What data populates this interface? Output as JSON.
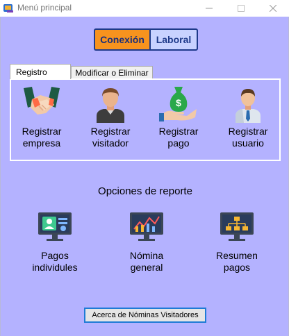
{
  "window": {
    "title": "Menú principal"
  },
  "logo": {
    "left_text": "Conexión",
    "right_text": "Laboral"
  },
  "tabs": [
    {
      "label": "Registro",
      "selected": true
    },
    {
      "label": "Modificar o Eliminar",
      "selected": false
    }
  ],
  "registro": {
    "items": [
      {
        "line1": "Registrar",
        "line2": "empresa",
        "icon": "handshake-icon"
      },
      {
        "line1": "Registrar",
        "line2": "visitador",
        "icon": "person-icon"
      },
      {
        "line1": "Registrar",
        "line2": "pago",
        "icon": "money-bag-hand-icon"
      },
      {
        "line1": "Registrar",
        "line2": "usuario",
        "icon": "user-tie-icon"
      }
    ]
  },
  "reportes": {
    "title": "Opciones de reporte",
    "items": [
      {
        "line1": "Pagos",
        "line2": "individules",
        "icon": "id-card-monitor-icon"
      },
      {
        "line1": "Nómina",
        "line2": "general",
        "icon": "chart-monitor-icon"
      },
      {
        "line1": "Resumen",
        "line2": "pagos",
        "icon": "hierarchy-monitor-icon"
      }
    ]
  },
  "about_button": {
    "label": "Acerca de Nóminas Visitadores"
  },
  "colors": {
    "background": "#b4b2ff",
    "logo_orange": "#f7931e",
    "logo_blue": "#1e3a8a",
    "focus_border": "#1e7bd6"
  }
}
